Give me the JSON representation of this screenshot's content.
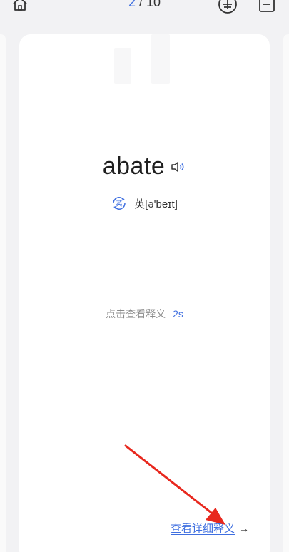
{
  "header": {
    "counter_current": "2",
    "counter_total": "/ 10",
    "home_icon": "home-icon",
    "plus_icon": "plus-circle-icon",
    "menu_icon": "list-icon"
  },
  "card": {
    "word": "abate",
    "speaker_icon": "speaker-icon",
    "phonetic": "英[ə'beɪt]",
    "phonetic_badge": "英",
    "hint": "点击查看释义",
    "countdown": "2s",
    "detail_link": "查看详细释义",
    "arrow": "→"
  },
  "colors": {
    "accent": "#3f6fe0",
    "annotation_arrow": "#e8281e",
    "background": "#f2f2f4"
  }
}
